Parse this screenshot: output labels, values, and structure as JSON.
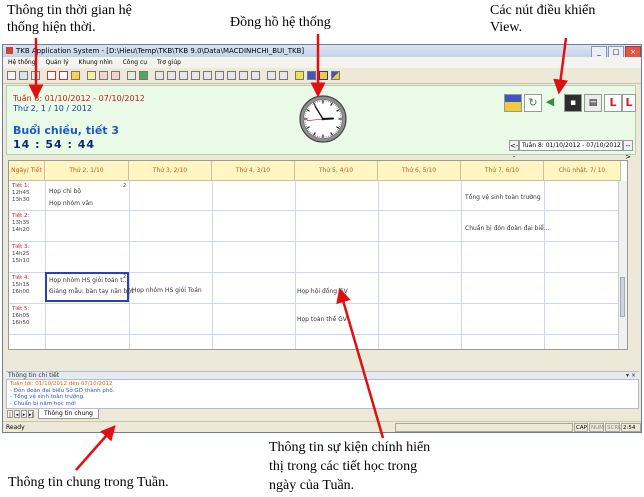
{
  "annotations": {
    "time_info": [
      "Thông tin thời gian hệ",
      "thống hiện thời."
    ],
    "clock": "Đồng hồ hệ thống",
    "view_buttons": [
      "Các nút điều khiển",
      "View."
    ],
    "week_info": "Thông tin chung trong Tuần.",
    "event_info": [
      "Thông tin sự kiện chính hiển",
      "thị trong các tiết học trong",
      "ngày của Tuần."
    ]
  },
  "window": {
    "title": "TKB Application System - [D:\\Hieu\\Temp\\TKB\\TKB 9.0\\Data\\MACDINHCHI_BUI_TKB]",
    "controls": [
      "_",
      "□",
      "×"
    ]
  },
  "menu": [
    "Hệ thống",
    "Quản lý",
    "Khung nhìn",
    "Công cụ",
    "Trợ giúp"
  ],
  "header": {
    "week_range": "Tuần 8: 01/10/2012 - 07/10/2012",
    "day_date": "Thứ 2, 1 / 10 / 2012",
    "session": "Buổi chiều, tiết 3",
    "time": "14 : 54 : 44",
    "week_select": "Tuần 8: 01/10/2012 - 07/10/2012",
    "prev": "<--",
    "next": "-->"
  },
  "clock_value": {
    "hour": 14,
    "minute": 54,
    "second": 44
  },
  "timetable": {
    "columns": [
      "Ngày/ Tiết",
      "Thứ 2, 1/10",
      "Thứ 3, 2/10",
      "Thứ 4, 3/10",
      "Thứ 5, 4/10",
      "Thứ 6, 5/10",
      "Thứ 7, 6/10",
      "Chủ nhật, 7/ 10"
    ],
    "periods": [
      {
        "label": "Tiết 1:",
        "start": "12h45",
        "end": "13h30"
      },
      {
        "label": "Tiết 2:",
        "start": "13h35",
        "end": "14h20"
      },
      {
        "label": "Tiết 3:",
        "start": "14h25",
        "end": "15h10"
      },
      {
        "label": "Tiết 4:",
        "start": "15h15",
        "end": "16h00"
      },
      {
        "label": "Tiết 5:",
        "start": "16h05",
        "end": "16h50"
      }
    ],
    "events": {
      "e1": "Họp chi bộ",
      "e1_badge": "2",
      "e2": "Họp nhóm văn",
      "e3": "Tổng vệ sinh toàn trường",
      "e4": "Chuẩn bị đón đoàn đại biể...",
      "e5": "Họp nhóm HS giỏi toán t...",
      "e5_badge": "2",
      "e6": "Giảng mẫu: bàn tay nặn bột",
      "e7": "Họp nhóm HS giỏi Toán",
      "e8": "Họp hội đồng GV",
      "e9": "Họp toàn thể GV"
    }
  },
  "detail": {
    "title": "Thông tin chi tiết",
    "controls": "▾ ×",
    "heading": "Tuần tới: 01/10/2012 đến 07/10/2012",
    "lines": [
      "- Đón đoàn đại biểu Sở GD thành phố.",
      "- Tổng vệ sinh toàn trường.",
      "- Chuẩn bị năm học mới"
    ],
    "tab": "Thông tin chung",
    "nav": [
      "|◂",
      "◂",
      "▸",
      "▸|"
    ]
  },
  "status": {
    "ready": "Ready",
    "caps": "CAP",
    "num": "NUM",
    "scrl": "SCRL",
    "clock": "2:54 PM"
  },
  "colors": {
    "accent_red": "#e01010",
    "header_bg": "#e9fbe7",
    "column_header_bg": "#fff6c2",
    "selection": "#2a3fbf"
  }
}
